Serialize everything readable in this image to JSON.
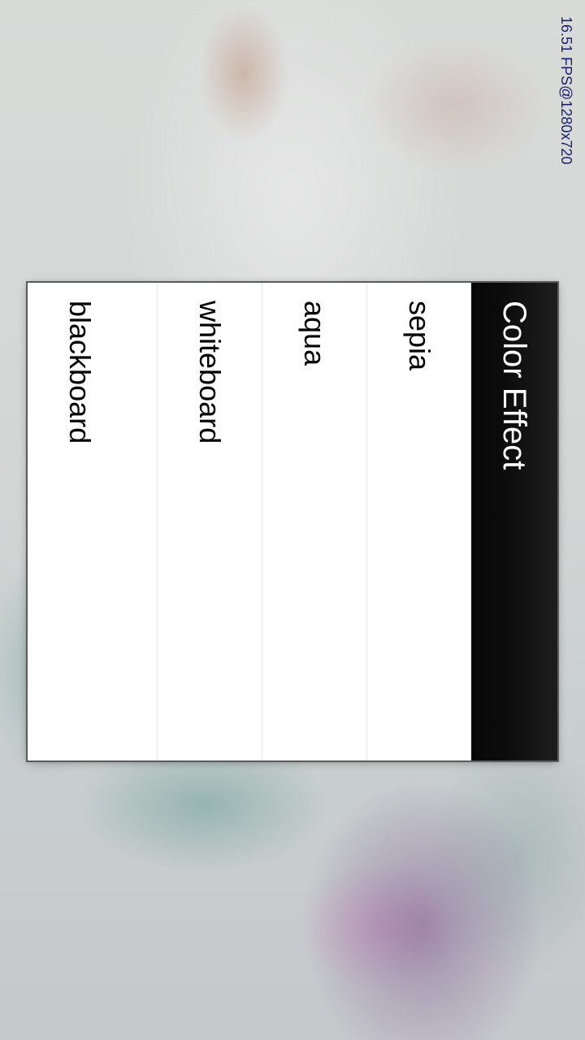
{
  "camera": {
    "fps_overlay": "16.51 FPS@1280x720"
  },
  "dialog": {
    "title": "Color Effect",
    "options": [
      {
        "label": "sepia"
      },
      {
        "label": "aqua"
      },
      {
        "label": "whiteboard"
      },
      {
        "label": "blackboard"
      }
    ]
  },
  "colors": {
    "title_bar_bg": "#0c0c0c",
    "title_text": "#ffffff",
    "list_bg": "#ffffff",
    "option_text": "#000000",
    "fps_text": "#1a1f6e"
  }
}
